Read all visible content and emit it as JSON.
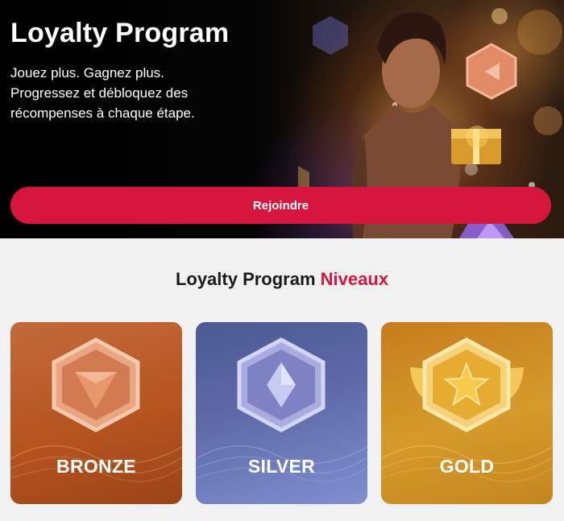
{
  "hero": {
    "title": "Loyalty Program",
    "subtitle_lines": [
      "Jouez plus. Gagnez plus.",
      "Progressez et débloquez des",
      "récompenses à chaque étape."
    ],
    "join_button": "Rejoindre"
  },
  "section": {
    "title": "Loyalty Program",
    "title_accent": "Niveaux"
  },
  "tiers": [
    {
      "label": "BRONZE",
      "icon": "bronze-triangle-hexagon-icon"
    },
    {
      "label": "SILVER",
      "icon": "silver-diamond-hexagon-icon"
    },
    {
      "label": "GOLD",
      "icon": "gold-star-winged-hexagon-icon"
    }
  ],
  "colors": {
    "accent": "#d5173e",
    "bronze": "#b55520",
    "silver": "#5e6aa8",
    "gold": "#d59a2c"
  }
}
